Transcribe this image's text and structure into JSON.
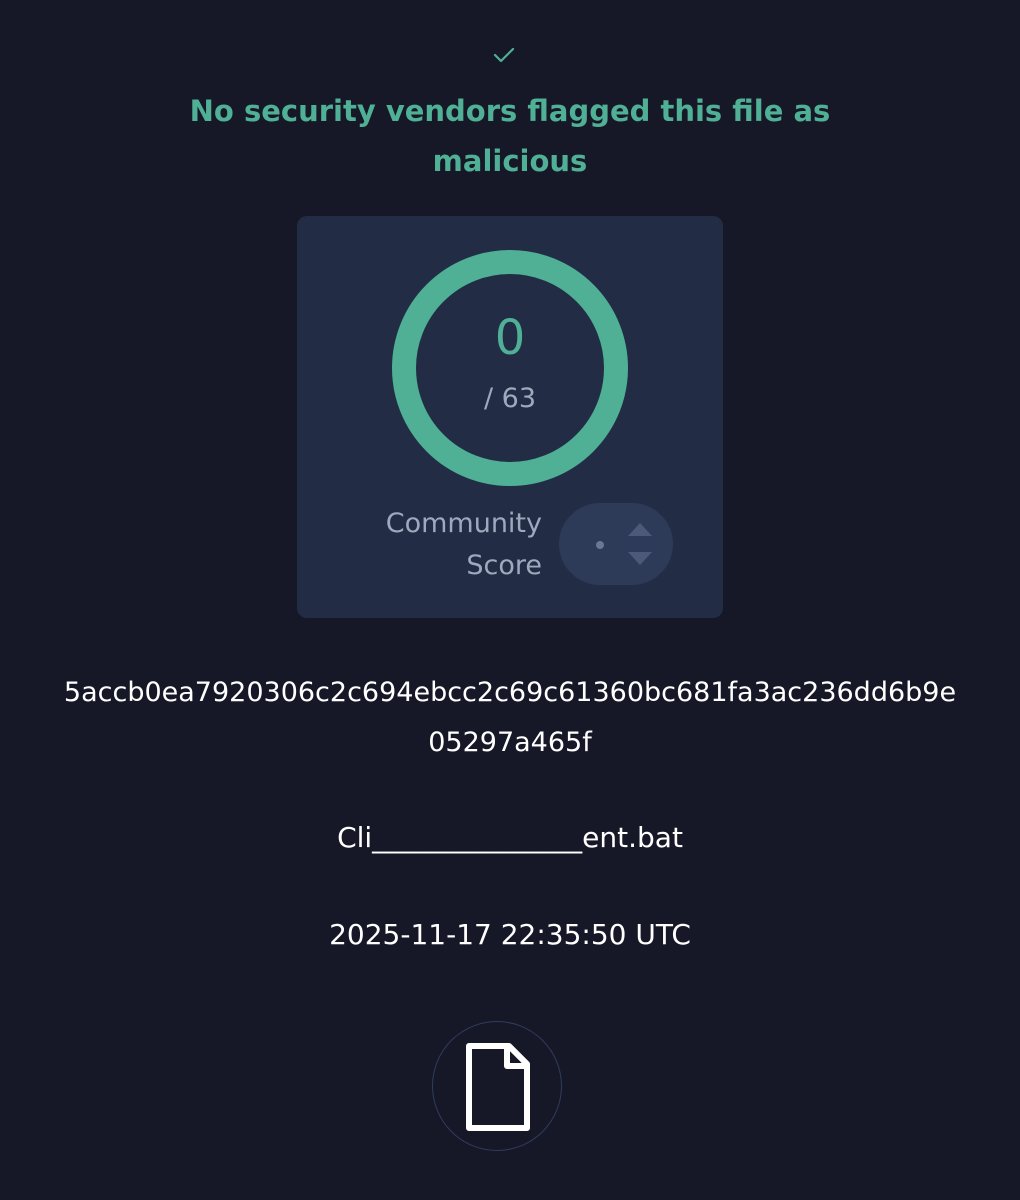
{
  "header": {
    "status_icon": "check-icon",
    "verdict": "No security vendors flagged this file as malicious",
    "accent_color": "#4fb096"
  },
  "score_card": {
    "detections": "0",
    "total": "/ 63",
    "detection_fraction": 0,
    "community_label": "Community Score",
    "community_value": "·",
    "vote_up_icon": "arrow-up-icon",
    "vote_down_icon": "arrow-down-icon"
  },
  "file": {
    "hash": "5accb0ea7920306c2c694ebcc2c69c61360bc681fa3ac236dd6b9e05297a465f",
    "name": "Cli_______________ent.bat",
    "timestamp": "2025-11-17 22:35:50 UTC",
    "type_icon": "file-icon"
  }
}
